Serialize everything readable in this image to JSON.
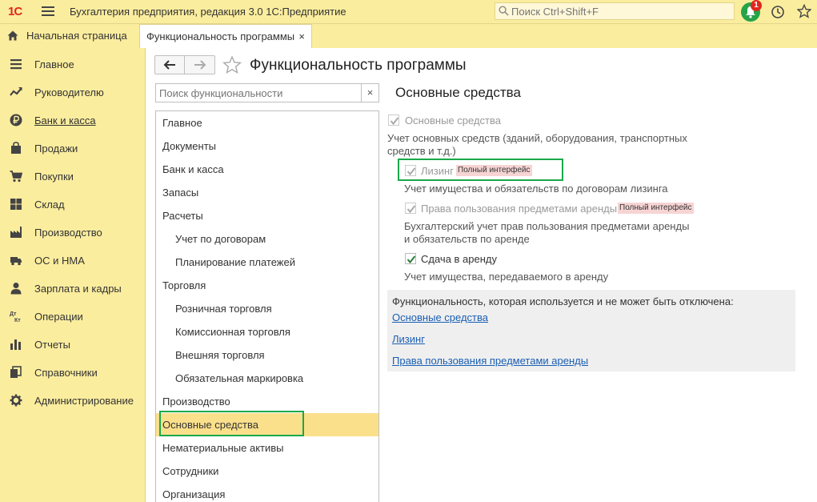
{
  "app": {
    "logo": "1С",
    "title": "Бухгалтерия предприятия, редакция 3.0 1С:Предприятие",
    "search_placeholder": "Поиск Ctrl+Shift+F",
    "notifications_count": "1"
  },
  "tabs": {
    "home": "Начальная страница",
    "active": "Функциональность программы",
    "close": "×"
  },
  "sidebar": {
    "items": [
      {
        "label": "Главное",
        "icon": "menu-list-icon"
      },
      {
        "label": "Руководителю",
        "icon": "trend-icon"
      },
      {
        "label": "Банк и касса",
        "icon": "ruble-icon"
      },
      {
        "label": "Продажи",
        "icon": "bag-icon"
      },
      {
        "label": "Покупки",
        "icon": "cart-icon"
      },
      {
        "label": "Склад",
        "icon": "warehouse-icon"
      },
      {
        "label": "Производство",
        "icon": "factory-icon"
      },
      {
        "label": "ОС и НМА",
        "icon": "truck-icon"
      },
      {
        "label": "Зарплата и кадры",
        "icon": "person-icon"
      },
      {
        "label": "Операции",
        "icon": "dt-kt-icon"
      },
      {
        "label": "Отчеты",
        "icon": "bar-chart-icon"
      },
      {
        "label": "Справочники",
        "icon": "books-icon"
      },
      {
        "label": "Администрирование",
        "icon": "gear-icon"
      }
    ],
    "icon_dt": "Дт",
    "icon_kt": "Кт"
  },
  "page": {
    "title": "Функциональность программы",
    "search_placeholder": "Поиск функциональности",
    "clear": "×"
  },
  "func_list": [
    {
      "label": "Главное",
      "sub": false
    },
    {
      "label": "Документы",
      "sub": false
    },
    {
      "label": "Банк и касса",
      "sub": false
    },
    {
      "label": "Запасы",
      "sub": false
    },
    {
      "label": "Расчеты",
      "sub": false
    },
    {
      "label": "Учет по договорам",
      "sub": true
    },
    {
      "label": "Планирование платежей",
      "sub": true
    },
    {
      "label": "Торговля",
      "sub": false
    },
    {
      "label": "Розничная торговля",
      "sub": true
    },
    {
      "label": "Комиссионная торговля",
      "sub": true
    },
    {
      "label": "Внешняя торговля",
      "sub": true
    },
    {
      "label": "Обязательная маркировка",
      "sub": true
    },
    {
      "label": "Производство",
      "sub": false
    },
    {
      "label": "Основные средства",
      "sub": false,
      "selected": true
    },
    {
      "label": "Нематериальные активы",
      "sub": false
    },
    {
      "label": "Сотрудники",
      "sub": false
    },
    {
      "label": "Организация",
      "sub": false
    }
  ],
  "section": {
    "title": "Основные средства",
    "opt1_label": "Основные средства",
    "opt1_desc_line1": "Учет основных средств (зданий, оборудования, транспортных",
    "opt1_desc_line2": "средств и т.д.)",
    "opt2_label": "Лизинг",
    "opt2_tag": "Полный интерфейс",
    "opt2_desc": "Учет имущества и обязательств  по договорам лизинга",
    "opt3_label": "Права пользования предметами аренды",
    "opt3_tag": "Полный интерфейс",
    "opt3_desc_line1": "Бухгалтерский учет прав пользования предметами аренды",
    "opt3_desc_line2": "и обязательств по аренде",
    "opt4_label": "Сдача в аренду",
    "opt4_desc": "Учет имущества, передаваемого в аренду"
  },
  "info_panel": {
    "caption": "Функциональность, которая используется и не может быть отключена:",
    "links": [
      "Основные средства",
      "Лизинг",
      "Права пользования предметами аренды"
    ]
  }
}
